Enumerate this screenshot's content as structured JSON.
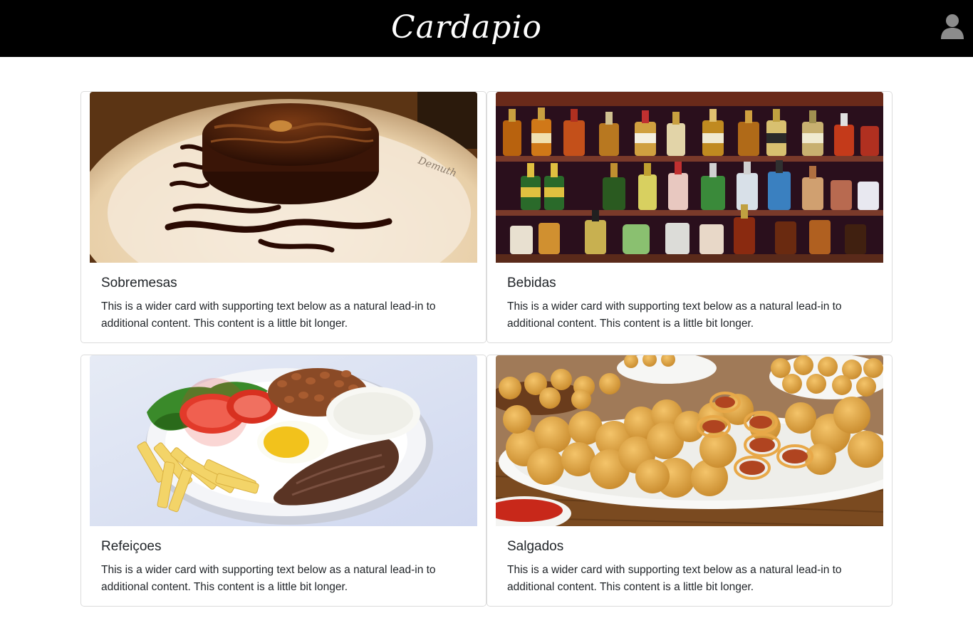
{
  "header": {
    "brand": "Cardapio",
    "user_icon": "user-icon",
    "background": "#000000"
  },
  "cards": [
    {
      "title": "Sobremesas",
      "text": "This is a wider card with supporting text below as a natural lead-in to additional content. This content is a little bit longer.",
      "image": "chocolate-cake-image"
    },
    {
      "title": "Bebidas",
      "text": "This is a wider card with supporting text below as a natural lead-in to additional content. This content is a little bit longer.",
      "image": "bar-bottles-image"
    },
    {
      "title": "Refeiçoes",
      "text": "This is a wider card with supporting text below as a natural lead-in to additional content. This content is a little bit longer.",
      "image": "meal-plate-image"
    },
    {
      "title": "Salgados",
      "text": "This is a wider card with supporting text below as a natural lead-in to additional content. This content is a little bit longer.",
      "image": "fried-snacks-image"
    }
  ]
}
